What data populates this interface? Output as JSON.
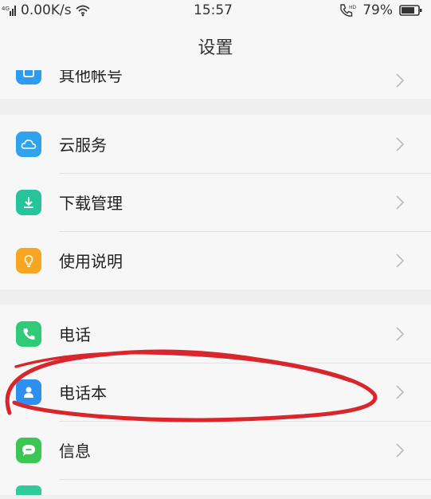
{
  "status_bar": {
    "network_speed": "0.00K/s",
    "time": "15:57",
    "battery": "79%"
  },
  "header": {
    "title": "设置"
  },
  "groups": [
    {
      "items": [
        {
          "label": "其他帐号",
          "icon": "account-icon",
          "color": "#2d9bf0"
        }
      ]
    },
    {
      "items": [
        {
          "label": "云服务",
          "icon": "cloud-icon",
          "color": "#2fa3ee"
        },
        {
          "label": "下载管理",
          "icon": "download-icon",
          "color": "#26c49b"
        },
        {
          "label": "使用说明",
          "icon": "lightbulb-icon",
          "color": "#f6a623"
        }
      ]
    },
    {
      "items": [
        {
          "label": "电话",
          "icon": "phone-icon",
          "color": "#2fcb78"
        },
        {
          "label": "电话本",
          "icon": "contacts-icon",
          "color": "#2d8ff0"
        },
        {
          "label": "信息",
          "icon": "message-icon",
          "color": "#3cc654"
        }
      ]
    }
  ],
  "colors": {
    "annotation_circle": "#d9262c"
  }
}
